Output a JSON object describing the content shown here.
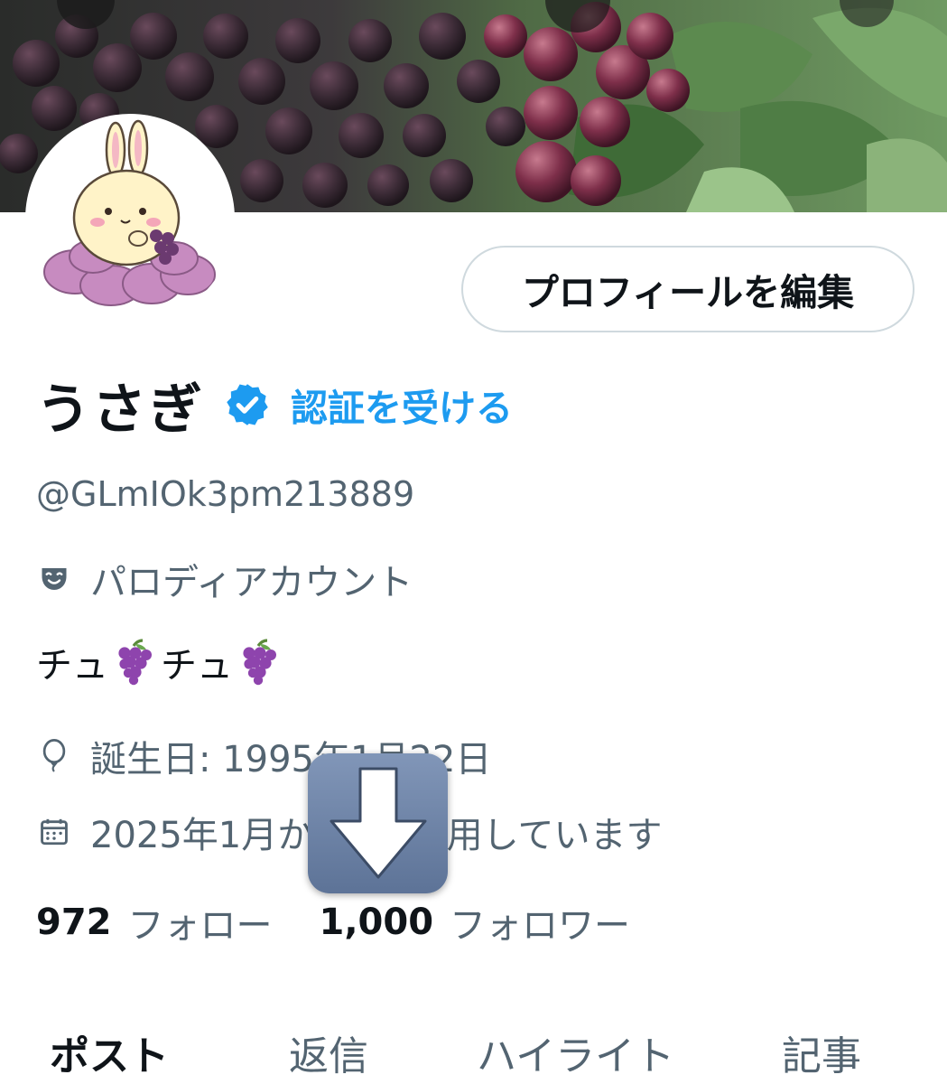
{
  "profile": {
    "display_name": "うさぎ",
    "get_verified_label": "認証を受ける",
    "handle": "@GLmIOk3pm213889",
    "parody_label": "パロディアカウント",
    "bio_part1": "チュ",
    "bio_part2": "チュ",
    "birthday": "誕生日: 1995年1月22日",
    "joined": "2025年1月からXを利用しています",
    "following_count": "972",
    "following_label": "フォロー",
    "followers_count": "1,000",
    "followers_label": "フォロワー"
  },
  "actions": {
    "edit_profile_label": "プロフィールを編集"
  },
  "tabs": [
    {
      "label": "ポスト",
      "active": true
    },
    {
      "label": "返信",
      "active": false
    },
    {
      "label": "ハイライト",
      "active": false
    },
    {
      "label": "記事",
      "active": false
    }
  ],
  "icons": {
    "verified": "verified-badge-icon",
    "parody": "theater-mask-icon",
    "birthday": "balloon-icon",
    "joined": "calendar-icon",
    "download": "download-arrow-icon"
  },
  "colors": {
    "accent": "#1d9bf0",
    "secondary_text": "#536471",
    "primary_text": "#0f1419"
  }
}
